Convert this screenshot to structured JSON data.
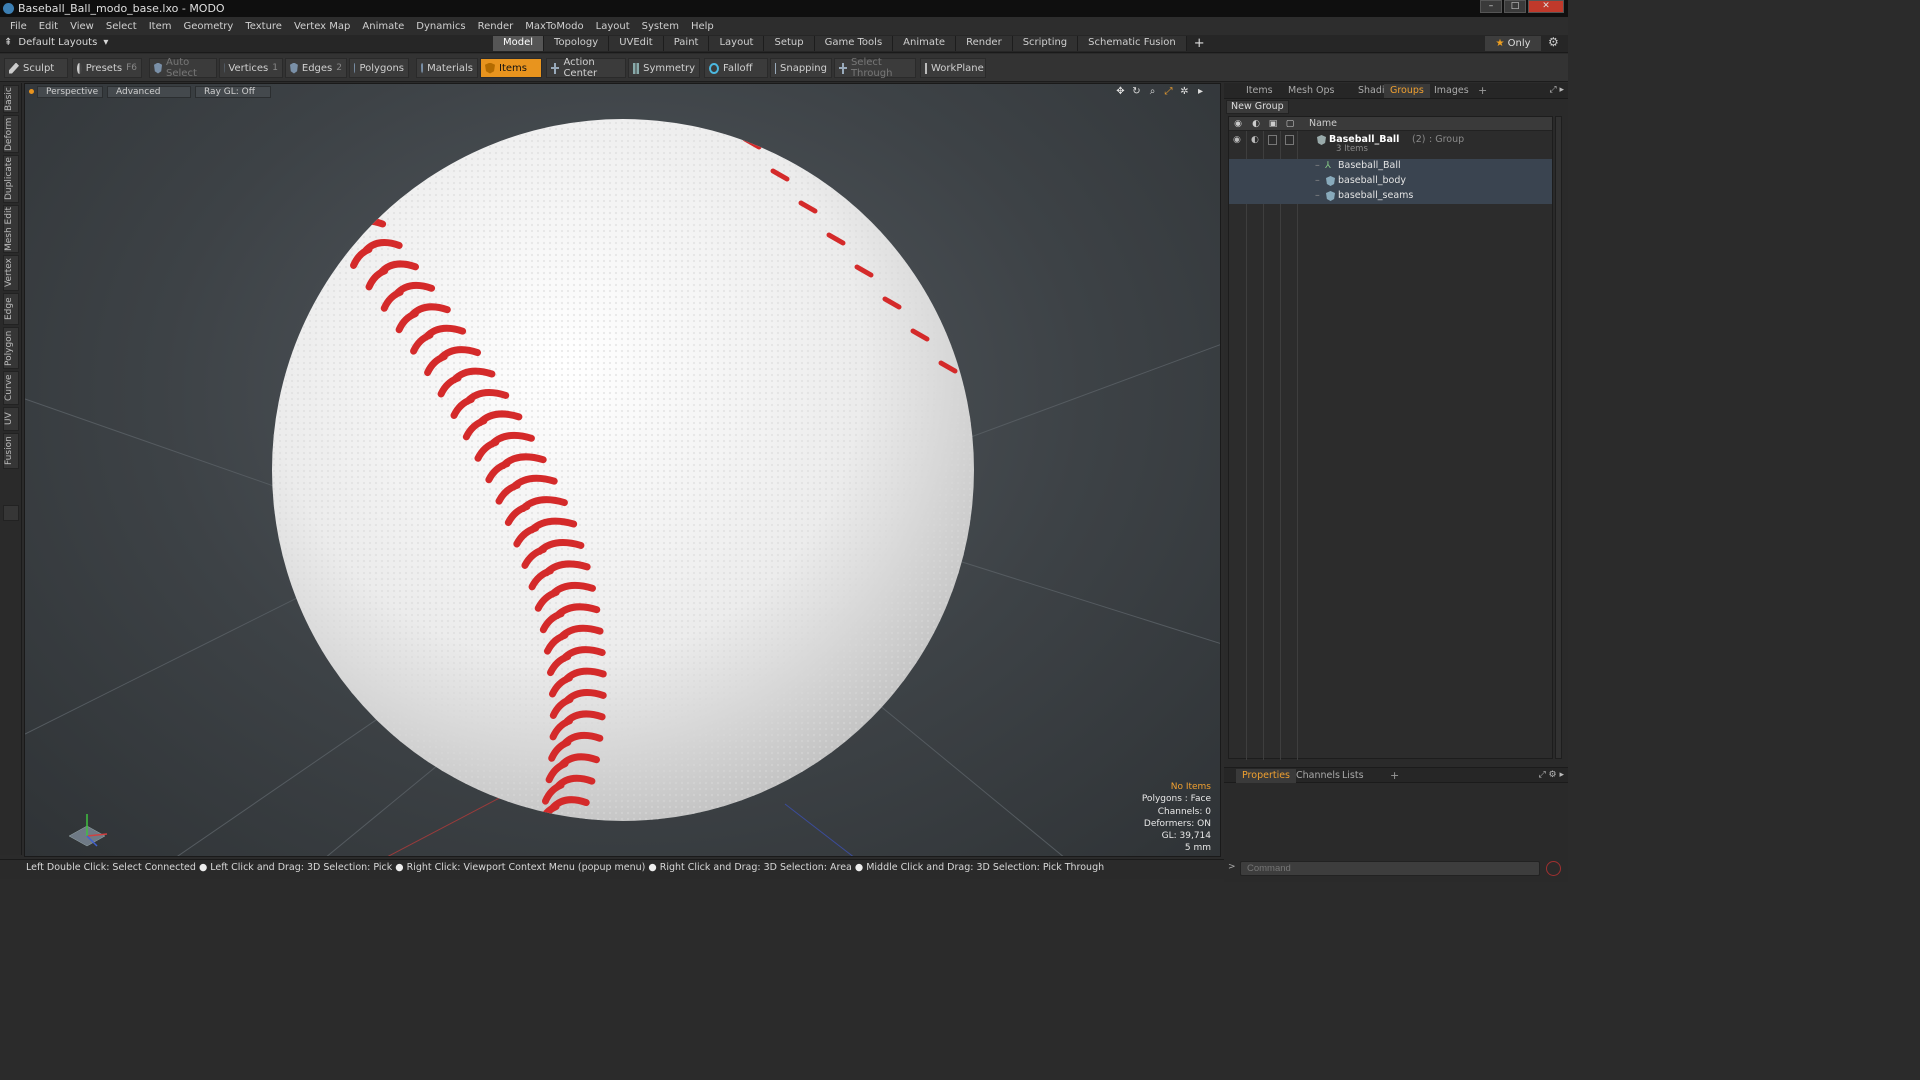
{
  "window": {
    "title": "Baseball_Ball_modo_base.lxo - MODO"
  },
  "menu": [
    "File",
    "Edit",
    "View",
    "Select",
    "Item",
    "Geometry",
    "Texture",
    "Vertex Map",
    "Animate",
    "Dynamics",
    "Render",
    "MaxToModo",
    "Layout",
    "System",
    "Help"
  ],
  "layout_bar": {
    "layouts_label": "Default Layouts",
    "tabs": [
      "Model",
      "Topology",
      "UVEdit",
      "Paint",
      "Layout",
      "Setup",
      "Game Tools",
      "Animate",
      "Render",
      "Scripting",
      "Schematic Fusion"
    ],
    "active_tab": "Model",
    "plus": "+",
    "only_label": "Only"
  },
  "toolbar": {
    "sculpt": "Sculpt",
    "presets": "Presets",
    "presets_key": "F6",
    "auto_select": "Auto Select",
    "vertices": "Vertices",
    "vertices_key": "1",
    "edges": "Edges",
    "edges_key": "2",
    "polygons": "Polygons",
    "materials": "Materials",
    "items": "Items",
    "action_center": "Action Center",
    "symmetry": "Symmetry",
    "falloff": "Falloff",
    "snapping": "Snapping",
    "select_through": "Select Through",
    "workplane": "WorkPlane"
  },
  "left_tabs": [
    "Basic",
    "Deform",
    "Duplicate",
    "Mesh Edit",
    "Vertex",
    "Edge",
    "Polygon",
    "Curve",
    "UV",
    "Fusion"
  ],
  "viewport": {
    "view_mode": "Perspective",
    "shading": "Advanced",
    "raygl": "Ray GL: Off",
    "info": {
      "selection": "No Items",
      "polygons": "Polygons : Face",
      "channels": "Channels: 0",
      "deformers": "Deformers: ON",
      "gl": "GL: 39,714",
      "unit": "5 mm"
    }
  },
  "status_bar": {
    "hints": [
      "Left Double Click: Select Connected",
      "Left Click and Drag: 3D Selection: Pick",
      "Right Click: Viewport Context Menu (popup menu)",
      "Right Click and Drag: 3D Selection: Area",
      "Middle Click and Drag: 3D Selection: Pick Through"
    ]
  },
  "right_panel": {
    "tabs": [
      "Items",
      "Mesh Ops",
      "Shading",
      "Groups",
      "Images"
    ],
    "active_tab": "Groups",
    "new_group": "New Group",
    "column_name": "Name",
    "group": {
      "name": "Baseball_Ball",
      "count": "(2)",
      "type": ": Group",
      "sub": "3 Items"
    },
    "items": [
      "Baseball_Ball",
      "baseball_body",
      "baseball_seams"
    ],
    "bottom_tabs": [
      "Properties",
      "Channels",
      "Lists"
    ],
    "bottom_active": "Properties",
    "command_placeholder": "Command"
  },
  "colors": {
    "accent": "#e8941e",
    "stitch": "#d42a2a",
    "ball": "#f2f2f2"
  }
}
